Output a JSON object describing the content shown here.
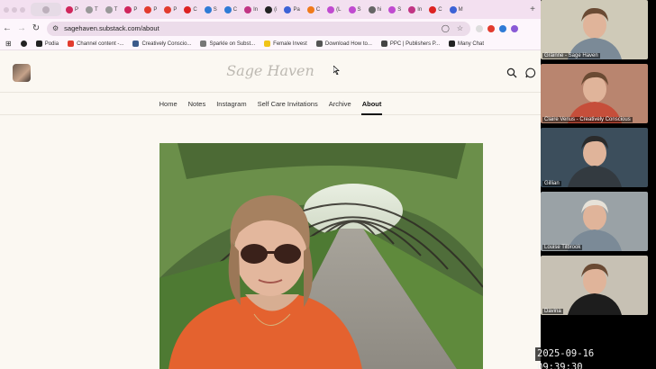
{
  "browser": {
    "tabs": [
      {
        "label": "",
        "color": "#bdb0bc"
      },
      {
        "label": "P",
        "color": "#d0265c"
      },
      {
        "label": "T",
        "color": "#999999"
      },
      {
        "label": "T",
        "color": "#999999"
      },
      {
        "label": "P",
        "color": "#d0265c"
      },
      {
        "label": "P",
        "color": "#e23b2e"
      },
      {
        "label": "P",
        "color": "#e23b2e"
      },
      {
        "label": "C",
        "color": "#d22"
      },
      {
        "label": "S",
        "color": "#2f7bd6"
      },
      {
        "label": "C",
        "color": "#2f7bd6"
      },
      {
        "label": "In",
        "color": "#c13584"
      },
      {
        "label": "(i",
        "color": "#222"
      },
      {
        "label": "Pa",
        "color": "#3c62d6"
      },
      {
        "label": "C",
        "color": "#f07a1a"
      },
      {
        "label": "(L",
        "color": "#c04ad0"
      },
      {
        "label": "S",
        "color": "#c04ad0"
      },
      {
        "label": "hi",
        "color": "#666"
      },
      {
        "label": "S",
        "color": "#c04ad0"
      },
      {
        "label": "In",
        "color": "#c13584"
      },
      {
        "label": "C",
        "color": "#d22"
      },
      {
        "label": "M",
        "color": "#3c62d6"
      }
    ],
    "url": "sagehaven.substack.com/about",
    "bookmarks": [
      {
        "label": "Podia",
        "color": "#222"
      },
      {
        "label": "Channel content -...",
        "color": "#e23b2e"
      },
      {
        "label": "Creatively Conscio...",
        "color": "#3b5a8a"
      },
      {
        "label": "Sparkle on Subst...",
        "color": "#777"
      },
      {
        "label": "Female Invest",
        "color": "#f0c419"
      },
      {
        "label": "Download How to...",
        "color": "#555"
      },
      {
        "label": "PPC | Publishers P...",
        "color": "#444"
      },
      {
        "label": "Many Chat",
        "color": "#222"
      }
    ],
    "extension_colors": [
      "#dddddd",
      "#e23b2e",
      "#2f7bd6",
      "#8a5ad6"
    ]
  },
  "site": {
    "title": "Sage Haven",
    "nav": [
      "Home",
      "Notes",
      "Instagram",
      "Self Care Invitations",
      "Archive",
      "About"
    ],
    "active_nav": "About"
  },
  "call": {
    "participants": [
      {
        "name": "Gráinne - Sage Haven",
        "bg": "#cfcab8"
      },
      {
        "name": "Claire Venus - Creatively Conscious",
        "bg": "#b9856f"
      },
      {
        "name": "Gillian",
        "bg": "#3c4e5c"
      },
      {
        "name": "Louise Tilbrook",
        "bg": "#9aa2a6"
      },
      {
        "name": "Davina",
        "bg": "#c7c1b4"
      }
    ]
  },
  "timestamp": "2025-09-16 09:39:30"
}
